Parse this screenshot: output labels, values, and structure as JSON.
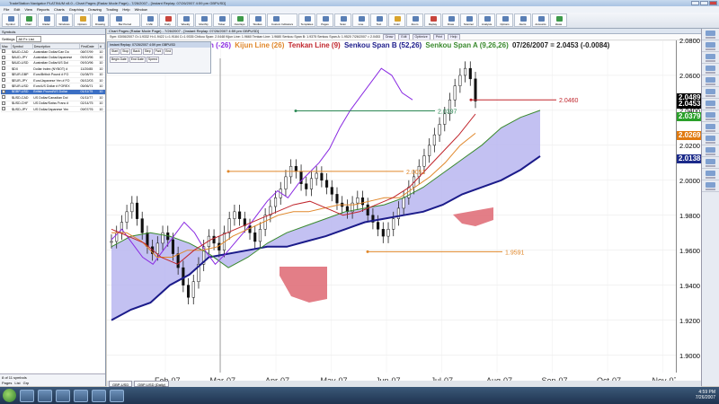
{
  "window": {
    "title": "TradeStation Navigator PLATINUM v8.0 - Chart Pages (Radar Mode Page) - 7/26/2007 - [Instant Replay: 07/26/2007 4:59 pm GBPUSD]"
  },
  "menu": [
    "File",
    "Edit",
    "View",
    "Reports",
    "Charts",
    "Graphing",
    "Drawing",
    "Trading",
    "Help",
    "Window"
  ],
  "toolbar": {
    "buttons": [
      "Symbol",
      "Chart",
      "Radar",
      "Windows",
      "Options",
      "Drawing",
      "Bar Period",
      "1 Min",
      "Daily",
      "Weekly",
      "Monthly",
      "Ticker",
      "Overlays",
      "Studies",
      "Custom Indicators",
      "Templates",
      "Pages",
      "Scan",
      "Line",
      "Text",
      "Color",
      "Zoom",
      "Replay",
      "Draw",
      "Scanner",
      "Analysis",
      "Options",
      "Alerts",
      "Accounts",
      "Ideas"
    ]
  },
  "left_panel": {
    "title": "Symbols",
    "settings_label": "Settings",
    "settings_value": "All Fx List",
    "columns": [
      "Mac",
      "Symbol",
      "Description",
      "FirstDate",
      "#"
    ],
    "rows": [
      {
        "symbol": "$AUD-CAD",
        "desc": "Australian Dollar/Can Do",
        "date": "08/07/99",
        "n": "10"
      },
      {
        "symbol": "$AUD-JPY",
        "desc": "Australian Dollar/Japanese",
        "date": "09/10/96",
        "n": "10"
      },
      {
        "symbol": "$AUD-USD",
        "desc": "Australian Dollar/US Dol",
        "date": "09/10/96",
        "n": "10"
      },
      {
        "symbol": "$DX",
        "desc": "Dollar Index (NYBOT) # ",
        "date": "11/20/85",
        "n": "10"
      },
      {
        "symbol": "$EUR-GBP",
        "desc": "Euro/British Pound # FO",
        "date": "01/08/79",
        "n": "10"
      },
      {
        "symbol": "$EUR-JPY",
        "desc": "Euro/Japanese Yen # FO",
        "date": "05/12/03",
        "n": "10"
      },
      {
        "symbol": "$EUR-USD",
        "desc": "Euro/US Dollar # FOREX",
        "date": "05/06/71",
        "n": "10"
      },
      {
        "symbol": "$GBP-USD",
        "desc": "British Pound/US Dollar",
        "date": "01/11/75",
        "n": "10",
        "selected": true
      },
      {
        "symbol": "$USD-CAD",
        "desc": "US Dollar/Canadian Dol",
        "date": "01/11/77",
        "n": "10"
      },
      {
        "symbol": "$USD-CHF",
        "desc": "US Dollar/Swiss Franc #",
        "date": "02/14/75",
        "n": "10"
      },
      {
        "symbol": "$USD-JPY",
        "desc": "US Dollar/Japanese Yen",
        "date": "09/07/76",
        "n": "10"
      }
    ],
    "footer_count": "8 of 11 symbols",
    "footer_tabs": [
      "Pages",
      "List",
      "Grp"
    ]
  },
  "chart_window": {
    "header": "Chart Pages (Radar Mode Page) - 7/26/2007 - [Instant Replay: 07/26/2007 4:59 pm GBPUSD]",
    "info_line": "Sym: 03/06/2007 O=1.9332 H=1.9422 L=1.9184 C=1.9335   Chikou Span: 2.0448  Kijun Line: 1.9660  Tenkan Line: 1.9680  Senkou Span B: 1.9375  Senkou Span A: 1.9520   7/26/2007 = 2.0453",
    "info_buttons": [
      "Draw",
      "Edit",
      "Optimize",
      "Print",
      "Help"
    ],
    "replay_title": "Instant Replay: 07/26/2007 4:59 pm GBPUSD",
    "replay_buttons": [
      "Start",
      "Stop",
      "Back",
      "Step",
      "Fwd",
      "End"
    ],
    "replay_labels": [
      "Begin Date",
      "End Date",
      "Speed"
    ],
    "bottom_tabs": [
      "GBP-USD",
      "GBP-USD (Daily)"
    ]
  },
  "indicator_legend": {
    "items": [
      {
        "text": "Chikou Span (-26)",
        "color": "#8a2be2"
      },
      {
        "text": "Kijun Line (26)",
        "color": "#e0872a"
      },
      {
        "text": "Tenkan Line (9)",
        "color": "#c0262d"
      },
      {
        "text": "Senkou Span B (52,26)",
        "color": "#1b1b8a"
      },
      {
        "text": "Senkou Span A (9,26,26)",
        "color": "#3a8a2e"
      }
    ],
    "quote": "07/26/2007 = 2.0453 (-0.0084)"
  },
  "price_badges": [
    {
      "value": "2.0489",
      "color": "#000000"
    },
    {
      "value": "2.0453",
      "color": "#000000"
    },
    {
      "value": "2.0379",
      "color": "#2aa02a"
    },
    {
      "value": "2.0269",
      "color": "#e07a10"
    },
    {
      "value": "2.0138",
      "color": "#1b2a8a"
    }
  ],
  "chart_annotations": [
    {
      "text": "2.0460",
      "color": "#c0262d"
    },
    {
      "text": "2.0051",
      "color": "#e0872a"
    },
    {
      "text": "1.9591",
      "color": "#e0872a"
    },
    {
      "text": "2.0397",
      "color": "#2e8b57"
    }
  ],
  "chart_data": {
    "type": "line",
    "xlabel": "",
    "ylabel": "",
    "ylim": [
      1.89,
      2.08
    ],
    "x_ticks": [
      "Feb-07",
      "Mar-07",
      "Apr-07",
      "May-07",
      "Jun-07",
      "Jul-07",
      "Aug-07",
      "Sep-07",
      "Oct-07",
      "Nov-07"
    ],
    "y_ticks": [
      "2.0800",
      "2.0600",
      "2.0400",
      "2.0200",
      "2.0000",
      "1.9800",
      "1.9600",
      "1.9400",
      "1.9200",
      "1.9000"
    ],
    "price_close": [
      1.965,
      1.97,
      1.976,
      1.982,
      1.987,
      1.978,
      1.97,
      1.962,
      1.958,
      1.964,
      1.97,
      1.966,
      1.958,
      1.95,
      1.94,
      1.933,
      1.942,
      1.952,
      1.962,
      1.968,
      1.964,
      1.96,
      1.97,
      1.978,
      1.982,
      1.978,
      1.974,
      1.97,
      1.965,
      1.972,
      1.98,
      1.985,
      1.99,
      1.995,
      2.002,
      2.008,
      2.005,
      1.998,
      1.995,
      2.001,
      2.004,
      2.0,
      1.996,
      1.992,
      1.987,
      1.985,
      1.982,
      1.987,
      1.99,
      1.986,
      1.98,
      1.976,
      1.972,
      1.968,
      1.972,
      1.978,
      1.984,
      1.99,
      1.996,
      2.002,
      2.008,
      2.014,
      2.02,
      2.026,
      2.032,
      2.038,
      2.046,
      2.054,
      2.06,
      2.064,
      2.058,
      2.0453
    ],
    "series": [
      {
        "name": "Chikou Span (-26)",
        "color": "#8a2be2",
        "values": [
          1.966,
          1.972,
          1.964,
          1.956,
          1.952,
          1.96,
          1.968,
          1.976,
          1.97,
          1.96,
          1.952,
          1.958,
          1.965,
          1.972,
          1.98,
          1.988,
          1.994,
          1.99,
          1.998,
          2.004,
          2.01,
          2.018,
          2.03,
          2.04,
          2.048,
          2.056,
          2.064,
          2.06,
          2.05,
          2.046
        ]
      },
      {
        "name": "Kijun Line (26)",
        "color": "#e0872a",
        "values": [
          1.97,
          1.97,
          1.965,
          1.956,
          1.956,
          1.96,
          1.96,
          1.962,
          1.968,
          1.972,
          1.976,
          1.98,
          1.982,
          1.982,
          1.984,
          1.986,
          1.986,
          1.988,
          1.99,
          1.99,
          1.996,
          2.002,
          2.01,
          2.02,
          2.0269
        ]
      },
      {
        "name": "Tenkan Line (9)",
        "color": "#c0262d",
        "values": [
          1.972,
          1.968,
          1.964,
          1.956,
          1.952,
          1.96,
          1.966,
          1.97,
          1.974,
          1.978,
          1.982,
          1.986,
          1.988,
          1.984,
          1.98,
          1.982,
          1.986,
          1.99,
          1.996,
          2.006,
          2.016,
          2.026,
          2.0379
        ]
      },
      {
        "name": "Senkou Span B (52,26)",
        "color": "#1b1b8a",
        "values": [
          1.92,
          1.926,
          1.93,
          1.94,
          1.946,
          1.956,
          1.958,
          1.96,
          1.962,
          1.962,
          1.965,
          1.968,
          1.972,
          1.976,
          1.978,
          1.98,
          1.982,
          1.986,
          1.992,
          1.996,
          2.0,
          2.006,
          2.0138
        ]
      },
      {
        "name": "Senkou Span A (9,26,26)",
        "color": "#3a8a2e",
        "values": [
          1.962,
          1.968,
          1.97,
          1.968,
          1.964,
          1.958,
          1.95,
          1.956,
          1.964,
          1.97,
          1.974,
          1.978,
          1.982,
          1.984,
          1.986,
          1.99,
          1.996,
          2.004,
          2.012,
          2.02,
          2.03,
          2.036,
          2.04
        ]
      }
    ]
  },
  "right_sidebar": {
    "items": [
      "Market",
      "News",
      "Quotes",
      "Orders",
      "Account",
      "Alerts",
      "Scans",
      "Studies",
      "Charts",
      "Pages",
      "Replay",
      "Ideas",
      "Tools",
      "Help"
    ]
  },
  "taskbar": {
    "time": "4:59 PM",
    "date": "7/26/2007"
  }
}
